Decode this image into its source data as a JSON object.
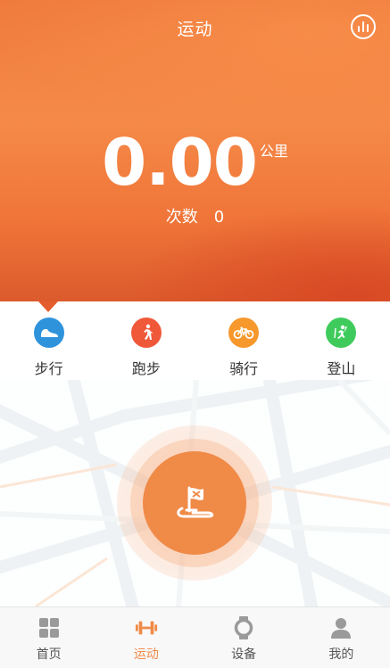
{
  "header": {
    "title": "运动"
  },
  "summary": {
    "distance_value": "0.00",
    "distance_unit": "公里",
    "count_label": "次数",
    "count_value": "0"
  },
  "sport_types": [
    {
      "label": "步行",
      "icon": "walk-shoe-icon",
      "color": "#2f93dc"
    },
    {
      "label": "跑步",
      "icon": "running-person-icon",
      "color": "#f0583a"
    },
    {
      "label": "骑行",
      "icon": "bicycle-icon",
      "color": "#f6982c"
    },
    {
      "label": "登山",
      "icon": "climbing-person-icon",
      "color": "#3fcb5c"
    }
  ],
  "selected_sport_index": 0,
  "start_button": {
    "icon": "start-flag-icon"
  },
  "bottom_nav": [
    {
      "label": "首页",
      "icon": "grid-home-icon",
      "active": false
    },
    {
      "label": "运动",
      "icon": "dumbbell-icon",
      "active": true
    },
    {
      "label": "设备",
      "icon": "watch-icon",
      "active": false
    },
    {
      "label": "我的",
      "icon": "person-icon",
      "active": false
    }
  ],
  "colors": {
    "accent": "#f08a47",
    "header_orange": "#f58a48",
    "inactive_icon": "#9a9a9a"
  }
}
